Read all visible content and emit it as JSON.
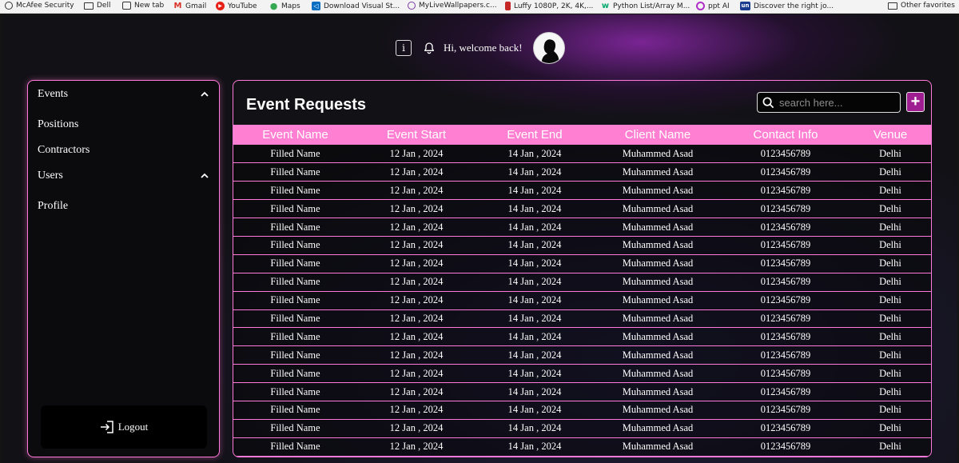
{
  "bookmarks": [
    {
      "label": "McAfee Security",
      "icon": "globe-icon"
    },
    {
      "label": "Dell",
      "icon": "folder-icon"
    },
    {
      "label": "New tab",
      "icon": "tab-icon"
    },
    {
      "label": "Gmail",
      "icon": "gmail-icon"
    },
    {
      "label": "YouTube",
      "icon": "youtube-icon"
    },
    {
      "label": "Maps",
      "icon": "maps-icon"
    },
    {
      "label": "Download Visual St...",
      "icon": "vscode-icon"
    },
    {
      "label": "MyLiveWallpapers.c...",
      "icon": "wallpaper-icon"
    },
    {
      "label": "Luffy 1080P, 2K, 4K,...",
      "icon": "luffy-icon"
    },
    {
      "label": "Python List/Array M...",
      "icon": "w3schools-icon"
    },
    {
      "label": "ppt AI",
      "icon": "ppt-ai-icon"
    },
    {
      "label": "Discover the right jo...",
      "icon": "unstop-icon"
    },
    {
      "label": "Other favorites",
      "icon": "folder-icon"
    }
  ],
  "header": {
    "info_label": "i",
    "welcome": "Hi, welcome back!"
  },
  "sidebar": {
    "items": [
      {
        "label": "Events",
        "has_chevron": true
      },
      {
        "label": "Positions",
        "has_chevron": false
      },
      {
        "label": "Contractors",
        "has_chevron": false
      },
      {
        "label": "Users",
        "has_chevron": true
      },
      {
        "label": "Profile",
        "has_chevron": false
      }
    ],
    "logout_label": "Logout"
  },
  "main": {
    "title": "Event Requests",
    "search_placeholder": "search here...",
    "add_label": "+",
    "columns": [
      "Event Name",
      "Event Start",
      "Event End",
      "Client Name",
      "Contact Info",
      "Venue"
    ],
    "rows": [
      [
        "Filled Name",
        "12 Jan , 2024",
        "14 Jan , 2024",
        "Muhammed Asad",
        "0123456789",
        "Delhi"
      ],
      [
        "Filled Name",
        "12 Jan , 2024",
        "14 Jan , 2024",
        "Muhammed Asad",
        "0123456789",
        "Delhi"
      ],
      [
        "Filled Name",
        "12 Jan , 2024",
        "14 Jan , 2024",
        "Muhammed Asad",
        "0123456789",
        "Delhi"
      ],
      [
        "Filled Name",
        "12 Jan , 2024",
        "14 Jan , 2024",
        "Muhammed Asad",
        "0123456789",
        "Delhi"
      ],
      [
        "Filled Name",
        "12 Jan , 2024",
        "14 Jan , 2024",
        "Muhammed Asad",
        "0123456789",
        "Delhi"
      ],
      [
        "Filled Name",
        "12 Jan , 2024",
        "14 Jan , 2024",
        "Muhammed Asad",
        "0123456789",
        "Delhi"
      ],
      [
        "Filled Name",
        "12 Jan , 2024",
        "14 Jan , 2024",
        "Muhammed Asad",
        "0123456789",
        "Delhi"
      ],
      [
        "Filled Name",
        "12 Jan , 2024",
        "14 Jan , 2024",
        "Muhammed Asad",
        "0123456789",
        "Delhi"
      ],
      [
        "Filled Name",
        "12 Jan , 2024",
        "14 Jan , 2024",
        "Muhammed Asad",
        "0123456789",
        "Delhi"
      ],
      [
        "Filled Name",
        "12 Jan , 2024",
        "14 Jan , 2024",
        "Muhammed Asad",
        "0123456789",
        "Delhi"
      ],
      [
        "Filled Name",
        "12 Jan , 2024",
        "14 Jan , 2024",
        "Muhammed Asad",
        "0123456789",
        "Delhi"
      ],
      [
        "Filled Name",
        "12 Jan , 2024",
        "14 Jan , 2024",
        "Muhammed Asad",
        "0123456789",
        "Delhi"
      ],
      [
        "Filled Name",
        "12 Jan , 2024",
        "14 Jan , 2024",
        "Muhammed Asad",
        "0123456789",
        "Delhi"
      ],
      [
        "Filled Name",
        "12 Jan , 2024",
        "14 Jan , 2024",
        "Muhammed Asad",
        "0123456789",
        "Delhi"
      ],
      [
        "Filled Name",
        "12 Jan , 2024",
        "14 Jan , 2024",
        "Muhammed Asad",
        "0123456789",
        "Delhi"
      ],
      [
        "Filled Name",
        "12 Jan , 2024",
        "14 Jan , 2024",
        "Muhammed Asad",
        "0123456789",
        "Delhi"
      ],
      [
        "Filled Name",
        "12 Jan , 2024",
        "14 Jan , 2024",
        "Muhammed Asad",
        "0123456789",
        "Delhi"
      ]
    ]
  },
  "colors": {
    "accent_pink": "#ff80d3",
    "border_pink": "#ff7ad9",
    "add_button": "#9e1e92",
    "background": "#121116"
  }
}
